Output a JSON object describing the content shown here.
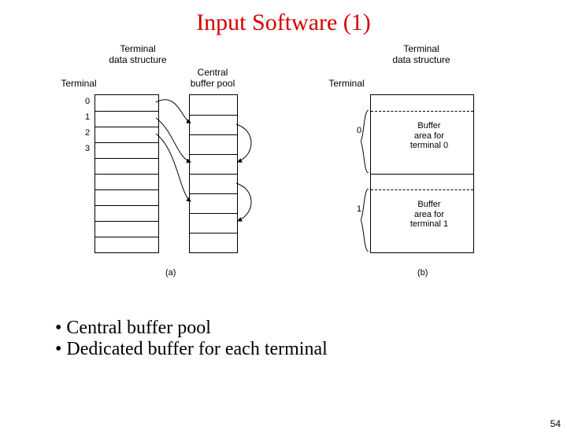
{
  "title": "Input Software (1)",
  "labels": {
    "tds_a": "Terminal\ndata structure",
    "tds_b": "Terminal\ndata structure",
    "terminal_a": "Terminal",
    "terminal_b": "Terminal",
    "central_pool": "Central\nbuffer pool",
    "buf0": "Buffer\narea for\nterminal 0",
    "buf1": "Buffer\narea for\nterminal 1",
    "cap_a": "(a)",
    "cap_b": "(b)"
  },
  "rows_a": [
    "0",
    "1",
    "2",
    "3"
  ],
  "rows_b": [
    "0",
    "1"
  ],
  "bullets": [
    "Central buffer pool",
    "Dedicated buffer for each terminal"
  ],
  "page": "54"
}
